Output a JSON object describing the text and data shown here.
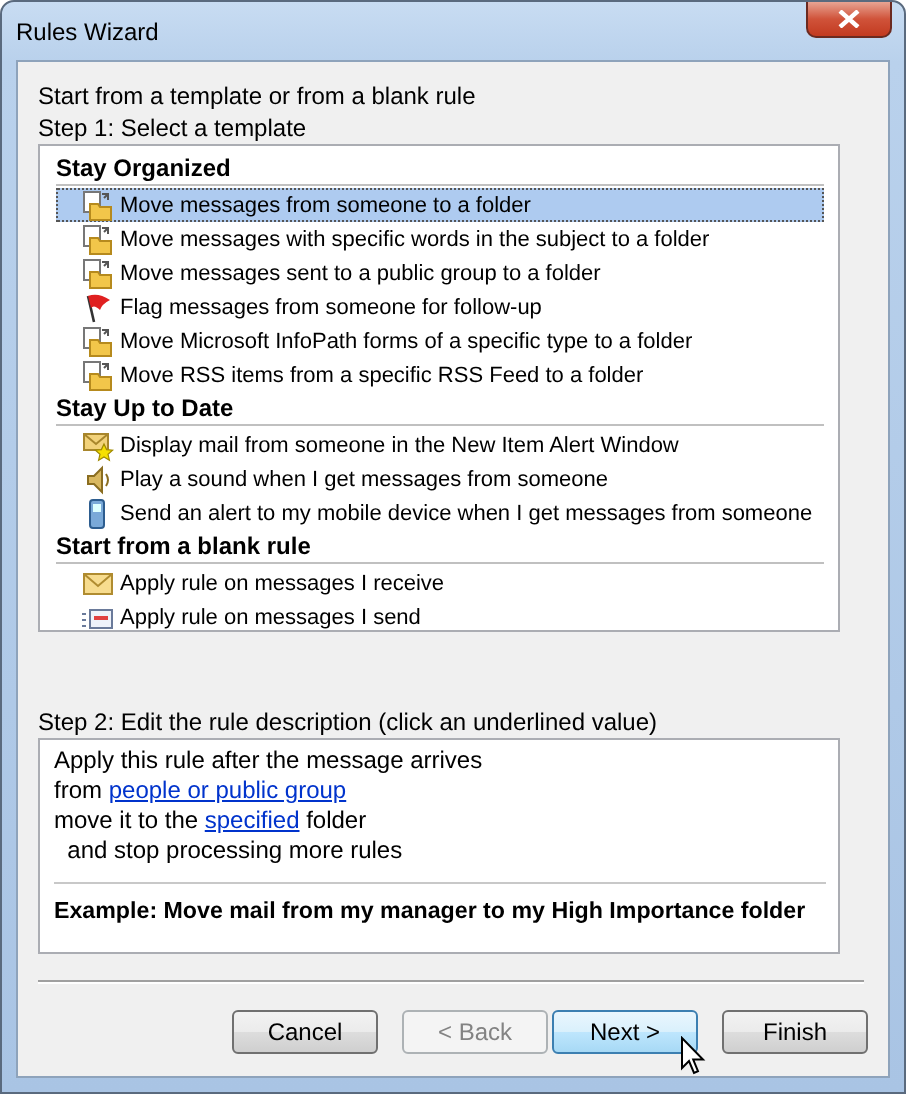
{
  "window": {
    "title": "Rules Wizard"
  },
  "intro": "Start from a template or from a blank rule",
  "step1_label": "Step 1: Select a template",
  "template_groups": [
    {
      "title": "Stay Organized",
      "items": [
        {
          "label": "Move messages from someone to a folder",
          "kind": "folder",
          "selected": true
        },
        {
          "label": "Move messages with specific words in the subject to a folder",
          "kind": "folder",
          "selected": false
        },
        {
          "label": "Move messages sent to a public group to a folder",
          "kind": "folder",
          "selected": false
        },
        {
          "label": "Flag messages from someone for follow-up",
          "kind": "flag",
          "selected": false
        },
        {
          "label": "Move Microsoft InfoPath forms of a specific type to a folder",
          "kind": "folder",
          "selected": false
        },
        {
          "label": "Move RSS items from a specific RSS Feed to a folder",
          "kind": "folder",
          "selected": false
        }
      ]
    },
    {
      "title": "Stay Up to Date",
      "items": [
        {
          "label": "Display mail from someone in the New Item Alert Window",
          "kind": "alert",
          "selected": false
        },
        {
          "label": "Play a sound when I get messages from someone",
          "kind": "sound",
          "selected": false
        },
        {
          "label": "Send an alert to my mobile device when I get messages from someone",
          "kind": "mobile",
          "selected": false
        }
      ]
    },
    {
      "title": "Start from a blank rule",
      "items": [
        {
          "label": "Apply rule on messages I receive",
          "kind": "envelope",
          "selected": false
        },
        {
          "label": "Apply rule on messages I send",
          "kind": "send",
          "selected": false
        }
      ]
    }
  ],
  "step2_label": "Step 2: Edit the rule description (click an underlined value)",
  "description": {
    "lines": [
      [
        {
          "text": "Apply this rule after the message arrives",
          "link": false
        }
      ],
      [
        {
          "text": "from ",
          "link": false
        },
        {
          "text": "people or public group",
          "link": true
        }
      ],
      [
        {
          "text": "move it to the ",
          "link": false
        },
        {
          "text": "specified",
          "link": true
        },
        {
          "text": " folder",
          "link": false
        }
      ],
      [
        {
          "text": "  and stop processing more rules",
          "link": false
        }
      ]
    ],
    "example": "Example: Move mail from my manager to my High Importance folder"
  },
  "buttons": [
    {
      "label": "Cancel",
      "disabled": false,
      "hovered": false
    },
    {
      "label": "< Back",
      "disabled": true,
      "hovered": false
    },
    {
      "label": "Next >",
      "disabled": false,
      "hovered": true
    },
    {
      "label": "Finish",
      "disabled": false,
      "hovered": false
    }
  ]
}
